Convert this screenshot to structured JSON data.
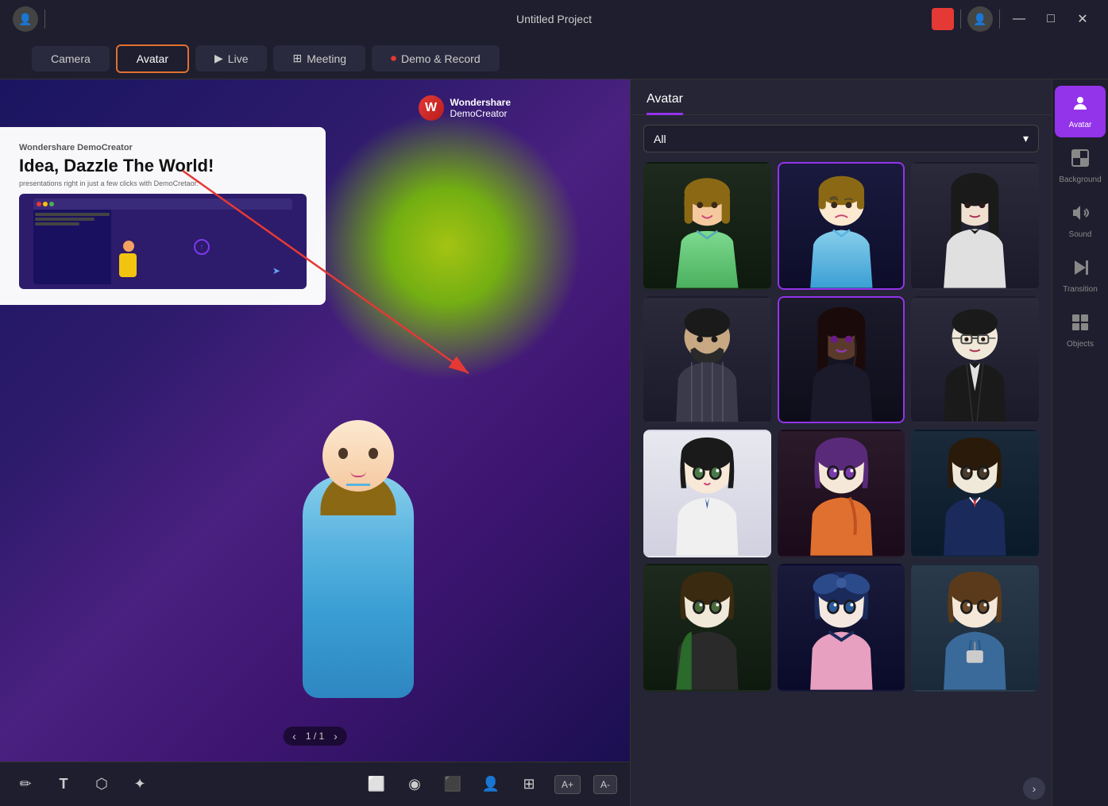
{
  "titlebar": {
    "title": "Untitled Project",
    "record_dot_color": "#e53935",
    "minimize": "—",
    "maximize": "□",
    "close": "✕"
  },
  "nav": {
    "tabs": [
      {
        "id": "camera",
        "label": "Camera",
        "icon": "",
        "active": false
      },
      {
        "id": "avatar",
        "label": "Avatar",
        "icon": "",
        "active": true
      },
      {
        "id": "live",
        "label": "Live",
        "icon": "▶",
        "active": false
      },
      {
        "id": "meeting",
        "label": "Meeting",
        "icon": "⊞",
        "active": false
      },
      {
        "id": "demo",
        "label": "Demo & Record",
        "icon": "⏺",
        "active": false
      }
    ]
  },
  "slide": {
    "brand": "Wondershare DemoCreator",
    "heading": "Idea, Dazzle The World!",
    "sub": "presentations right in just a few clicks with DemoCretaor.",
    "ws_logo_line1": "Wondershare",
    "ws_logo_line2": "DemoCreator"
  },
  "pagination": {
    "prev": "‹",
    "info": "1 / 1",
    "next": "›"
  },
  "toolbar": {
    "tools": [
      {
        "id": "pen",
        "icon": "✏",
        "label": "pen"
      },
      {
        "id": "text",
        "icon": "T",
        "label": "text"
      },
      {
        "id": "shape",
        "icon": "⬡",
        "label": "shape"
      },
      {
        "id": "stamp",
        "icon": "✦",
        "label": "stamp"
      }
    ],
    "right_tools": [
      {
        "id": "screen",
        "icon": "⬜",
        "label": "screen"
      },
      {
        "id": "camera2",
        "icon": "◉",
        "label": "camera"
      },
      {
        "id": "record",
        "icon": "⬛",
        "label": "record"
      },
      {
        "id": "person",
        "icon": "👤",
        "label": "person"
      },
      {
        "id": "multi",
        "icon": "⊞",
        "label": "multi"
      }
    ],
    "text_increase": "A+",
    "text_decrease": "A-"
  },
  "avatar_panel": {
    "title": "Avatar",
    "filter": {
      "selected": "All",
      "chevron": "▾"
    },
    "avatars": [
      {
        "id": 1,
        "name": "female-casual-green",
        "selected": false
      },
      {
        "id": 2,
        "name": "male-formal-blue",
        "selected": true
      },
      {
        "id": 3,
        "name": "female-formal-dark",
        "selected": false
      },
      {
        "id": 4,
        "name": "male-dark-beard",
        "selected": false
      },
      {
        "id": 5,
        "name": "female-dark-skin",
        "selected": true
      },
      {
        "id": 6,
        "name": "male-glasses-vest",
        "selected": false
      },
      {
        "id": 7,
        "name": "male-anime-white",
        "selected": false
      },
      {
        "id": 8,
        "name": "female-anime-purple",
        "selected": false
      },
      {
        "id": 9,
        "name": "male-anime-navy",
        "selected": false
      },
      {
        "id": 10,
        "name": "male-anime-casual",
        "selected": false
      },
      {
        "id": 11,
        "name": "female-anime-blue-bow",
        "selected": false
      },
      {
        "id": 12,
        "name": "female-anime-hoodie",
        "selected": false
      }
    ],
    "scroll_more": "›"
  },
  "right_sidebar": {
    "items": [
      {
        "id": "avatar",
        "label": "Avatar",
        "icon": "👤",
        "active": true
      },
      {
        "id": "background",
        "label": "Background",
        "icon": "⊞",
        "active": false
      },
      {
        "id": "sound",
        "label": "Sound",
        "icon": "♪",
        "active": false
      },
      {
        "id": "transition",
        "label": "Transition",
        "icon": "⏭",
        "active": false
      },
      {
        "id": "objects",
        "label": "Objects",
        "icon": "⊞",
        "active": false
      }
    ]
  }
}
